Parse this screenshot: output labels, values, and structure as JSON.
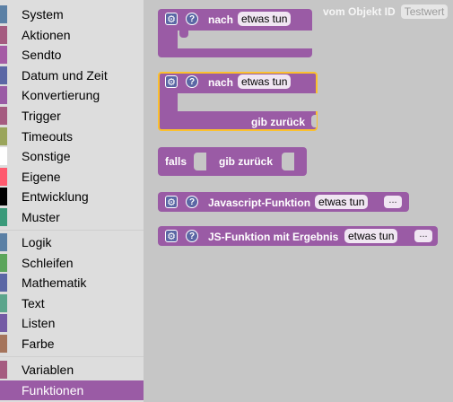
{
  "toolbox": {
    "categories": [
      {
        "label": "System",
        "color": "#5b80a5"
      },
      {
        "label": "Aktionen",
        "color": "#a55b80"
      },
      {
        "label": "Sendto",
        "color": "#a55ba5"
      },
      {
        "label": "Datum und Zeit",
        "color": "#5b67a5"
      },
      {
        "label": "Konvertierung",
        "color": "#9a5ba5"
      },
      {
        "label": "Trigger",
        "color": "#a55b80"
      },
      {
        "label": "Timeouts",
        "color": "#9aa55b"
      },
      {
        "label": "Sonstige",
        "color": "#ffffff"
      },
      {
        "label": "Eigene",
        "color": "#ff5a6e"
      },
      {
        "label": "Entwicklung",
        "color": "#000000"
      },
      {
        "label": "Muster",
        "color": "#3a9a7a"
      }
    ],
    "categories2": [
      {
        "label": "Logik",
        "color": "#5b80a5"
      },
      {
        "label": "Schleifen",
        "color": "#5ba55b"
      },
      {
        "label": "Mathematik",
        "color": "#5b67a5"
      },
      {
        "label": "Text",
        "color": "#5ba58c"
      },
      {
        "label": "Listen",
        "color": "#745ba5"
      },
      {
        "label": "Farbe",
        "color": "#a5745b"
      }
    ],
    "categories3": [
      {
        "label": "Variablen",
        "color": "#a55b80"
      },
      {
        "label": "Funktionen",
        "color": "#9a5ba5",
        "selected": true
      }
    ]
  },
  "workspace": {
    "ghost": {
      "text": "vom Objekt ID",
      "field": "Testwert"
    },
    "block1": {
      "keyword": "nach",
      "name": "etwas tun"
    },
    "block2": {
      "keyword": "nach",
      "name": "etwas tun",
      "return_label": "gib zurück"
    },
    "block3": {
      "keyword": "falls",
      "return_label": "gib zurück"
    },
    "block4": {
      "label": "Javascript-Funktion",
      "name": "etwas tun",
      "dots": "..."
    },
    "block5": {
      "label": "JS-Funktion mit Ergebnis",
      "name": "etwas tun",
      "dots": "..."
    }
  }
}
